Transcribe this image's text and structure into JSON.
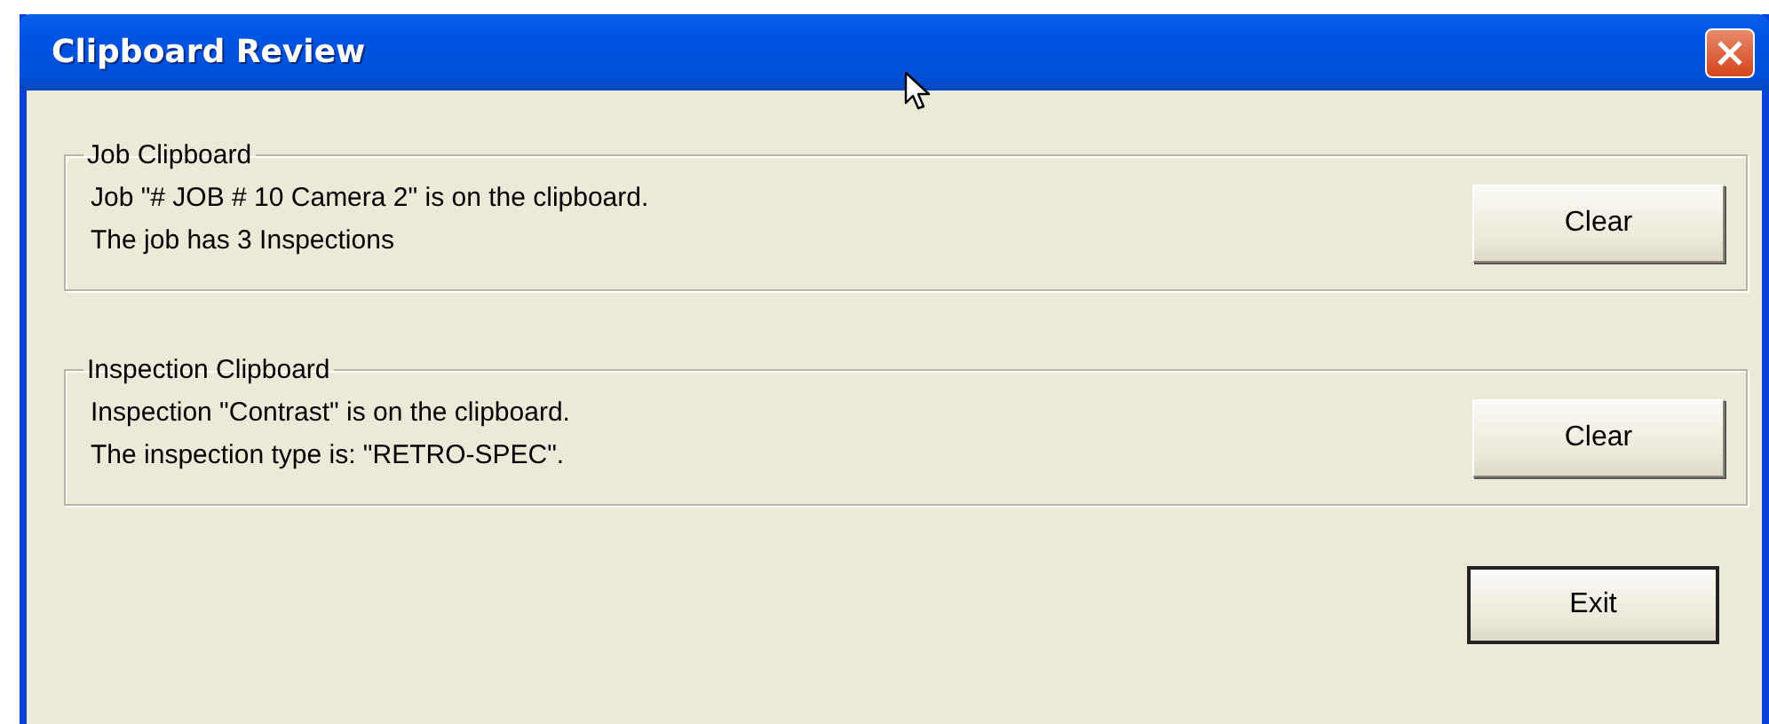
{
  "window": {
    "title": "Clipboard Review"
  },
  "groups": [
    {
      "legend": "Job Clipboard",
      "lines": [
        "Job \"# JOB # 10 Camera 2\" is on the clipboard.",
        "The job has 3 Inspections"
      ],
      "button": "Clear"
    },
    {
      "legend": "Inspection Clipboard",
      "lines": [
        "Inspection \"Contrast\" is on the clipboard.",
        "The inspection type is: \"RETRO-SPEC\"."
      ],
      "button": "Clear"
    }
  ],
  "buttons": [
    {
      "label": "Exit",
      "default": true
    }
  ]
}
